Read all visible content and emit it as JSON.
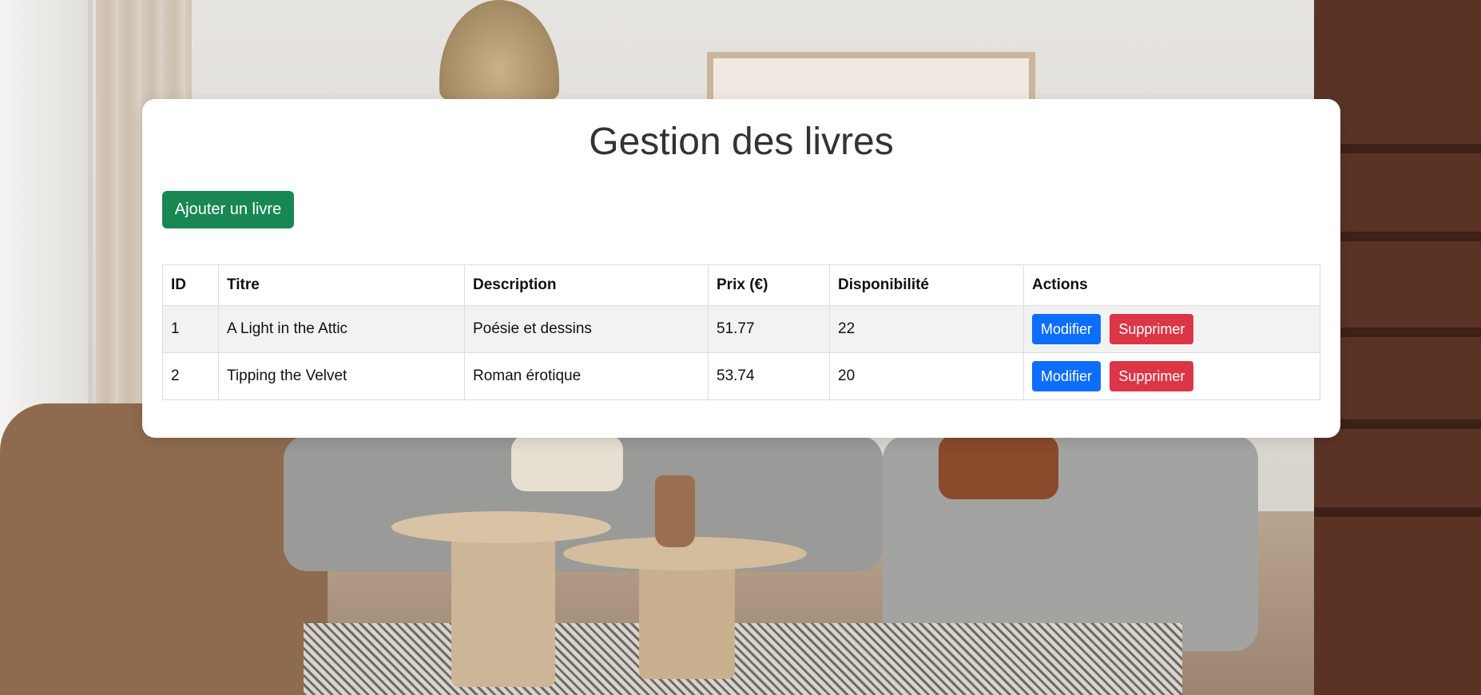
{
  "page": {
    "title": "Gestion des livres",
    "add_button_label": "Ajouter un livre"
  },
  "table": {
    "headers": [
      "ID",
      "Titre",
      "Description",
      "Prix (€)",
      "Disponibilité",
      "Actions"
    ],
    "rows": [
      {
        "id": "1",
        "title": "A Light in the Attic",
        "description": "Poésie et dessins",
        "price": "51.77",
        "availability": "22",
        "edit_label": "Modifier",
        "delete_label": "Supprimer"
      },
      {
        "id": "2",
        "title": "Tipping the Velvet",
        "description": "Roman érotique",
        "price": "53.74",
        "availability": "20",
        "edit_label": "Modifier",
        "delete_label": "Supprimer"
      }
    ]
  },
  "colors": {
    "add_button": "#198754",
    "edit_button": "#0d6efd",
    "delete_button": "#dc3545",
    "title_text": "#333333"
  },
  "background": {
    "scene": "living-room-photo"
  }
}
